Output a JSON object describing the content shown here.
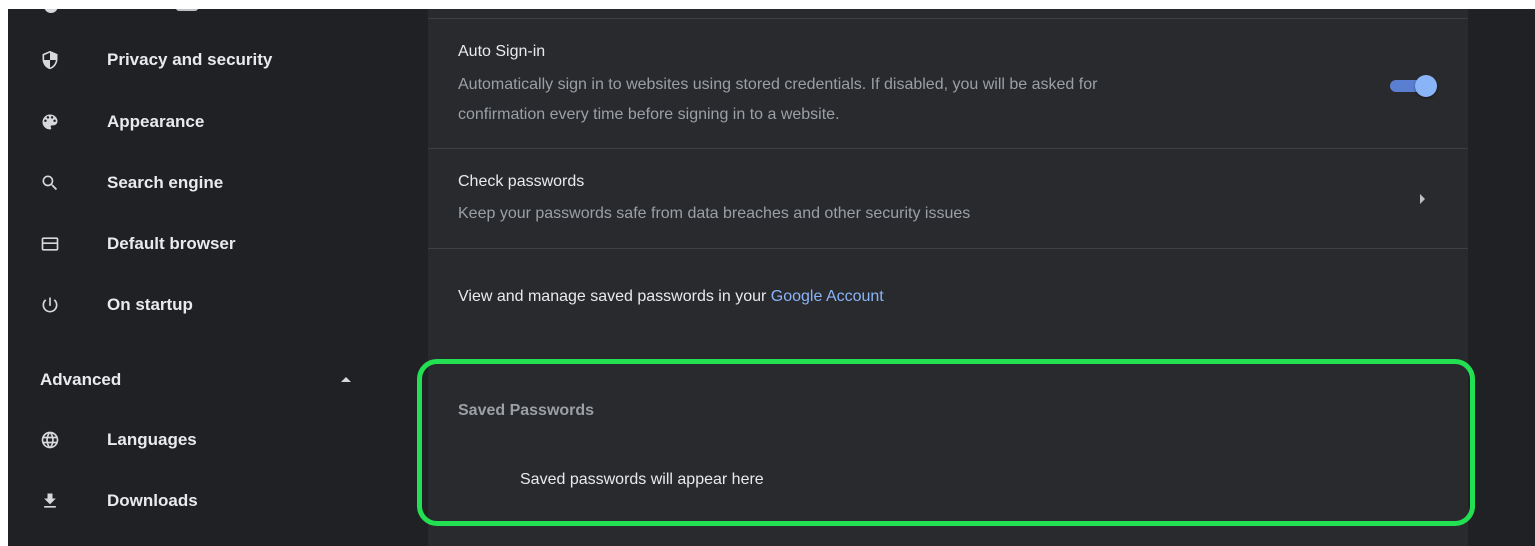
{
  "sidebar": {
    "items": [
      {
        "label": "Privacy and security",
        "icon": "shield-icon"
      },
      {
        "label": "Appearance",
        "icon": "palette-icon"
      },
      {
        "label": "Search engine",
        "icon": "search-icon"
      },
      {
        "label": "Default browser",
        "icon": "browser-window-icon"
      },
      {
        "label": "On startup",
        "icon": "power-icon"
      }
    ],
    "advanced": {
      "label": "Advanced",
      "icon": "chevron-up-icon"
    },
    "advanced_items": [
      {
        "label": "Languages",
        "icon": "globe-icon"
      },
      {
        "label": "Downloads",
        "icon": "download-icon"
      }
    ]
  },
  "main": {
    "auto_signin": {
      "title": "Auto Sign-in",
      "description_line1": "Automatically sign in to websites using stored credentials. If disabled, you will be asked for",
      "description_line2": "confirmation every time before signing in to a website.",
      "enabled": true
    },
    "check_passwords": {
      "title": "Check passwords",
      "description": "Keep your passwords safe from data breaches and other security issues",
      "icon": "chevron-right-icon"
    },
    "manage": {
      "text": "View and manage saved passwords in your ",
      "link": "Google Account"
    },
    "saved_passwords": {
      "heading": "Saved Passwords",
      "empty_text": "Saved passwords will appear here"
    }
  },
  "colors": {
    "background": "#202124",
    "card": "#292a2d",
    "accent": "#8ab4f8",
    "highlight": "#22e052"
  }
}
